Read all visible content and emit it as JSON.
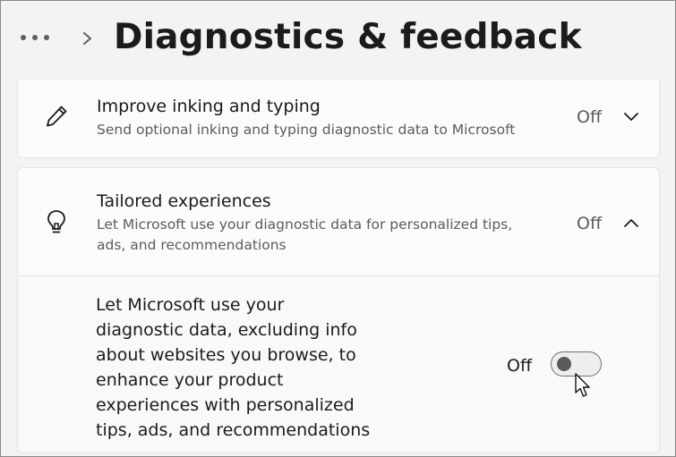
{
  "header": {
    "title": "Diagnostics & feedback",
    "more_icon": "more-horizontal-icon",
    "breadcrumb_separator_icon": "chevron-right-icon"
  },
  "inking": {
    "icon": "pen-icon",
    "title": "Improve inking and typing",
    "description": "Send optional inking and typing diagnostic data to Microsoft",
    "state": "Off",
    "expand_icon": "chevron-down-icon"
  },
  "tailored": {
    "icon": "lightbulb-icon",
    "title": "Tailored experiences",
    "description": "Let Microsoft use your diagnostic data for personalized tips, ads, and recommendations",
    "state": "Off",
    "expand_icon": "chevron-up-icon",
    "setting": {
      "text": "Let Microsoft use your diagnostic data, excluding info about websites you browse, to enhance your product experiences with personalized tips, ads, and recommendations",
      "toggle_label": "Off",
      "toggle_on": false
    }
  },
  "colors": {
    "background": "#f3f3f3",
    "card": "#fbfbfb",
    "text_primary": "#1b1b1b",
    "text_secondary": "#5c5c5c"
  }
}
